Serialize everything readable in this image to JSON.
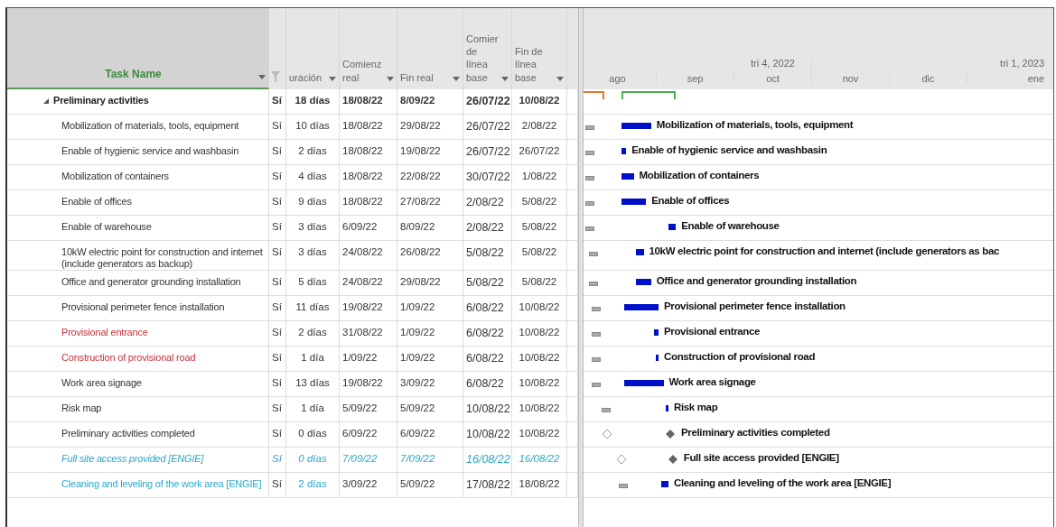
{
  "table": {
    "columns": [
      {
        "label": "Task Name",
        "kind": "name"
      },
      {
        "kind": "filter"
      },
      {
        "label": "uración",
        "kind": "num"
      },
      {
        "label": "Comienz real",
        "kind": "date"
      },
      {
        "label": "Fin real",
        "kind": "date"
      },
      {
        "label": "Comier de línea base",
        "kind": "date"
      },
      {
        "label": "Fin de línea base",
        "kind": "date"
      }
    ],
    "rows": [
      {
        "kind": "summary",
        "name": "Preliminary activities",
        "flag": "Sí",
        "duration": "18 días",
        "start": "18/08/22",
        "finish": "8/09/22",
        "base_start": "26/07/22",
        "base_finish": "10/08/22",
        "color": "#222222",
        "italic": false,
        "duration_colored": false
      },
      {
        "kind": "task",
        "name": "Mobilization of materials, tools, equipment",
        "flag": "Sí",
        "duration": "10 días",
        "start": "18/08/22",
        "finish": "29/08/22",
        "base_start": "26/07/22",
        "base_finish": "2/08/22",
        "bar_label": "Mobilization of materials, tools, equipment",
        "color": "#333333",
        "italic": false,
        "duration_colored": false
      },
      {
        "kind": "task",
        "name": "Enable of hygienic service and washbasin",
        "flag": "Sí",
        "duration": "2 días",
        "start": "18/08/22",
        "finish": "19/08/22",
        "base_start": "26/07/22",
        "base_finish": "26/07/22",
        "bar_label": "Enable of hygienic service and washbasin",
        "color": "#333333",
        "italic": false,
        "duration_colored": false
      },
      {
        "kind": "task",
        "name": "Mobilization of containers",
        "flag": "Sí",
        "duration": "4 días",
        "start": "18/08/22",
        "finish": "22/08/22",
        "base_start": "30/07/22",
        "base_finish": "1/08/22",
        "bar_label": "Mobilization of containers",
        "color": "#333333",
        "italic": false,
        "duration_colored": false
      },
      {
        "kind": "task",
        "name": "Enable of offices",
        "flag": "Sí",
        "duration": "9 días",
        "start": "18/08/22",
        "finish": "27/08/22",
        "base_start": "2/08/22",
        "base_finish": "5/08/22",
        "bar_label": "Enable of offices",
        "color": "#333333",
        "italic": false,
        "duration_colored": false
      },
      {
        "kind": "task",
        "name": "Enable of warehouse",
        "flag": "Sí",
        "duration": "3 días",
        "start": "6/09/22",
        "finish": "8/09/22",
        "base_start": "2/08/22",
        "base_finish": "5/08/22",
        "bar_label": "Enable of warehouse",
        "color": "#333333",
        "italic": false,
        "duration_colored": false
      },
      {
        "kind": "task",
        "name": "10kW electric point for construction and internet (include generators as backup)",
        "flag": "Sí",
        "duration": "3 días",
        "start": "24/08/22",
        "finish": "26/08/22",
        "base_start": "5/08/22",
        "base_finish": "5/08/22",
        "bar_label": "10kW electric point for construction and internet (include generators as bac",
        "color": "#333333",
        "italic": false,
        "duration_colored": false
      },
      {
        "kind": "task",
        "name": "Office and generator grounding installation",
        "flag": "Sí",
        "duration": "5 días",
        "start": "24/08/22",
        "finish": "29/08/22",
        "base_start": "5/08/22",
        "base_finish": "5/08/22",
        "bar_label": "Office and generator grounding installation",
        "color": "#333333",
        "italic": false,
        "duration_colored": false
      },
      {
        "kind": "task",
        "name": "Provisional perimeter fence installation",
        "flag": "Sí",
        "duration": "11 días",
        "start": "19/08/22",
        "finish": "1/09/22",
        "base_start": "6/08/22",
        "base_finish": "10/08/22",
        "bar_label": "Provisional perimeter fence installation",
        "color": "#333333",
        "italic": false,
        "duration_colored": false
      },
      {
        "kind": "task",
        "name": "Provisional entrance",
        "flag": "Sí",
        "duration": "2 días",
        "start": "31/08/22",
        "finish": "1/09/22",
        "base_start": "6/08/22",
        "base_finish": "10/08/22",
        "bar_label": "Provisional entrance",
        "color": "#c8323c",
        "italic": false,
        "duration_colored": false
      },
      {
        "kind": "task",
        "name": "Construction of provisional road",
        "flag": "Sí",
        "duration": "1 día",
        "start": "1/09/22",
        "finish": "1/09/22",
        "base_start": "6/08/22",
        "base_finish": "10/08/22",
        "bar_label": "Construction of provisional road",
        "color": "#c8323c",
        "italic": false,
        "duration_colored": false
      },
      {
        "kind": "task",
        "name": "Work area signage",
        "flag": "Sí",
        "duration": "13 días",
        "start": "19/08/22",
        "finish": "3/09/22",
        "base_start": "6/08/22",
        "base_finish": "10/08/22",
        "bar_label": "Work area signage",
        "color": "#333333",
        "italic": false,
        "duration_colored": false
      },
      {
        "kind": "task",
        "name": "Risk map",
        "flag": "Sí",
        "duration": "1 día",
        "start": "5/09/22",
        "finish": "5/09/22",
        "base_start": "10/08/22",
        "base_finish": "10/08/22",
        "bar_label": "Risk map",
        "color": "#333333",
        "italic": false,
        "duration_colored": false
      },
      {
        "kind": "milestone",
        "name": "Preliminary activities completed",
        "flag": "Sí",
        "duration": "0 días",
        "start": "6/09/22",
        "finish": "6/09/22",
        "base_start": "10/08/22",
        "base_finish": "10/08/22",
        "bar_label": "Preliminary activities completed",
        "color": "#333333",
        "italic": false,
        "duration_colored": false
      },
      {
        "kind": "milestone",
        "name": "Full site access provided [ENGIE]",
        "flag": "Sí",
        "duration": "0 días",
        "start": "7/09/22",
        "finish": "7/09/22",
        "base_start": "16/08/22",
        "base_finish": "16/08/22",
        "bar_label": "Full site access provided [ENGIE]",
        "color": "#2aa7c9",
        "italic": true,
        "duration_colored": true
      },
      {
        "kind": "task",
        "name": "Cleaning and leveling of the work area [ENGIE]",
        "flag": "Sí",
        "duration": "2 días",
        "start": "3/09/22",
        "finish": "5/09/22",
        "base_start": "17/08/22",
        "base_finish": "18/08/22",
        "bar_label": "Cleaning and leveling of the work area [ENGIE]",
        "color": "#2aa7c9",
        "italic": false,
        "duration_colored": true
      }
    ]
  },
  "timeline": {
    "months": [
      {
        "label": "ago"
      },
      {
        "label": "sep"
      },
      {
        "label": "oct",
        "quarter": "tri 4, 2022"
      },
      {
        "label": "nov"
      },
      {
        "label": "dic"
      },
      {
        "label": "ene",
        "quarter": "tri 1, 2023"
      }
    ]
  }
}
